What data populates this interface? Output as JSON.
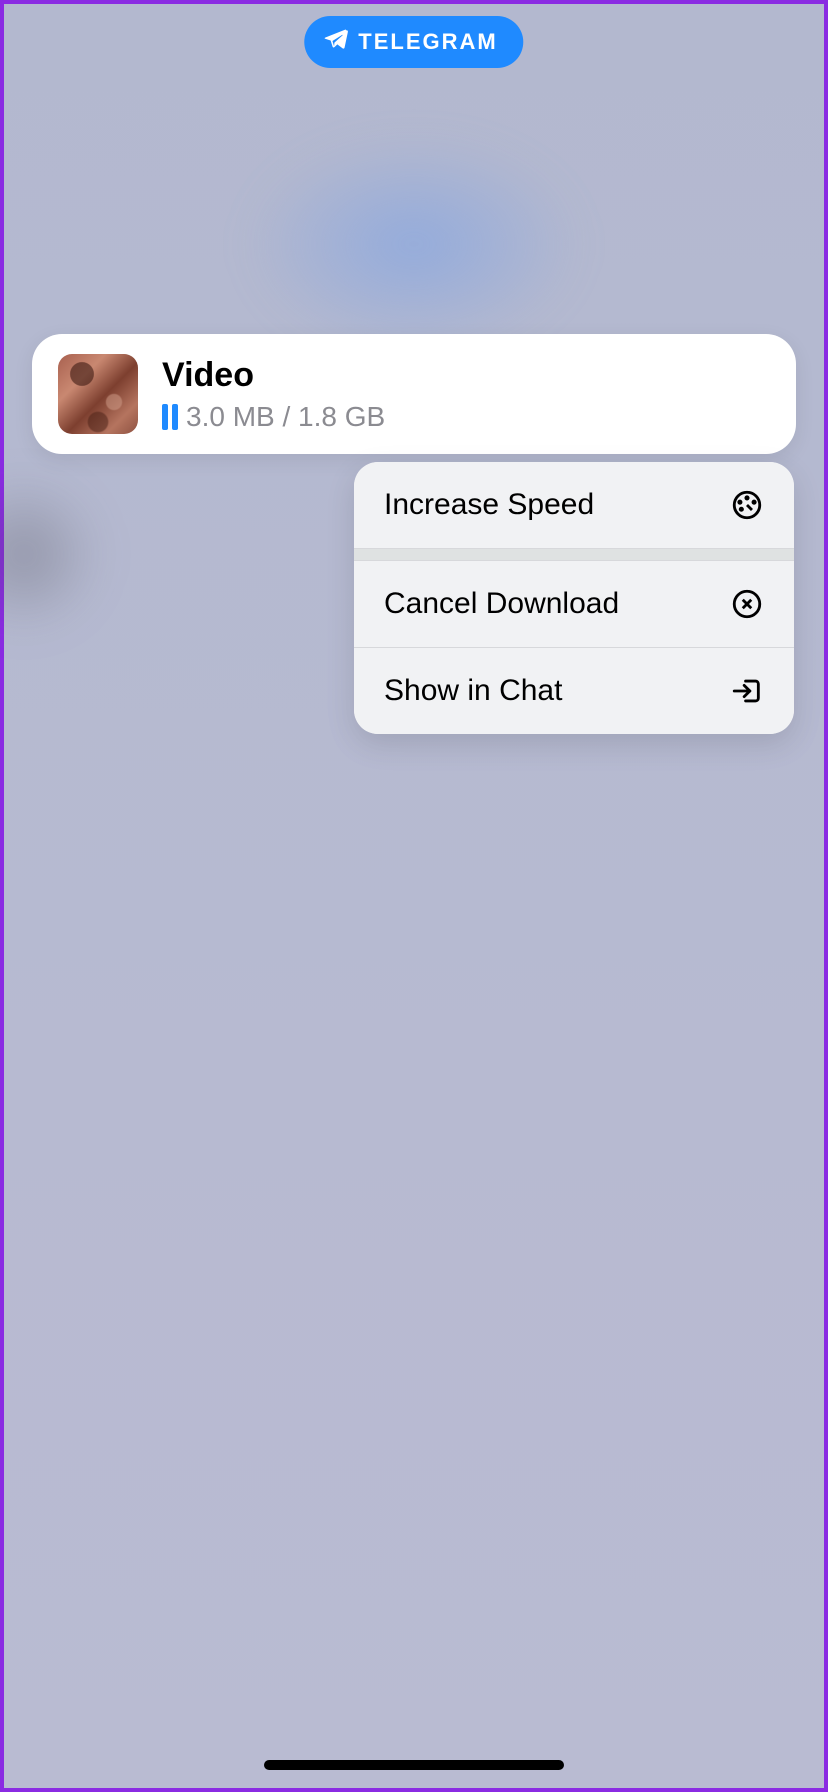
{
  "header": {
    "app_label": "TELEGRAM"
  },
  "download": {
    "title": "Video",
    "progress_text": "3.0 MB / 1.8 GB"
  },
  "menu": {
    "increase_speed": "Increase Speed",
    "cancel_download": "Cancel Download",
    "show_in_chat": "Show in Chat"
  }
}
